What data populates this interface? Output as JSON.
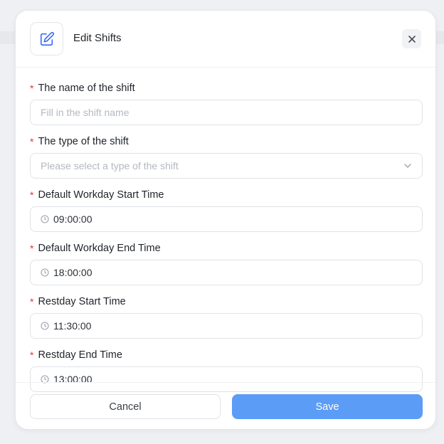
{
  "modal": {
    "title": "Edit Shifts",
    "header_icon": "edit-icon",
    "close_icon": "close-icon"
  },
  "form": {
    "shift_name": {
      "label": "The name of the shift",
      "required_marker": "*",
      "value": "",
      "placeholder": "Fill in the shift name"
    },
    "shift_type": {
      "label": "The type of the shift",
      "required_marker": "*",
      "value": "",
      "placeholder": "Please select a type of the shift"
    },
    "workday_start": {
      "label": "Default Workday Start Time",
      "required_marker": "*",
      "value": "09:00:00"
    },
    "workday_end": {
      "label": "Default Workday End Time",
      "required_marker": "*",
      "value": "18:00:00"
    },
    "restday_start": {
      "label": "Restday Start Time",
      "required_marker": "*",
      "value": "11:30:00"
    },
    "restday_end": {
      "label": "Restday End Time",
      "required_marker": "*",
      "value": "13:00:00"
    }
  },
  "footer": {
    "cancel_label": "Cancel",
    "save_label": "Save"
  },
  "colors": {
    "accent": "#5b9cf6",
    "icon_blue": "#3b6ef5",
    "required": "#e53935"
  }
}
